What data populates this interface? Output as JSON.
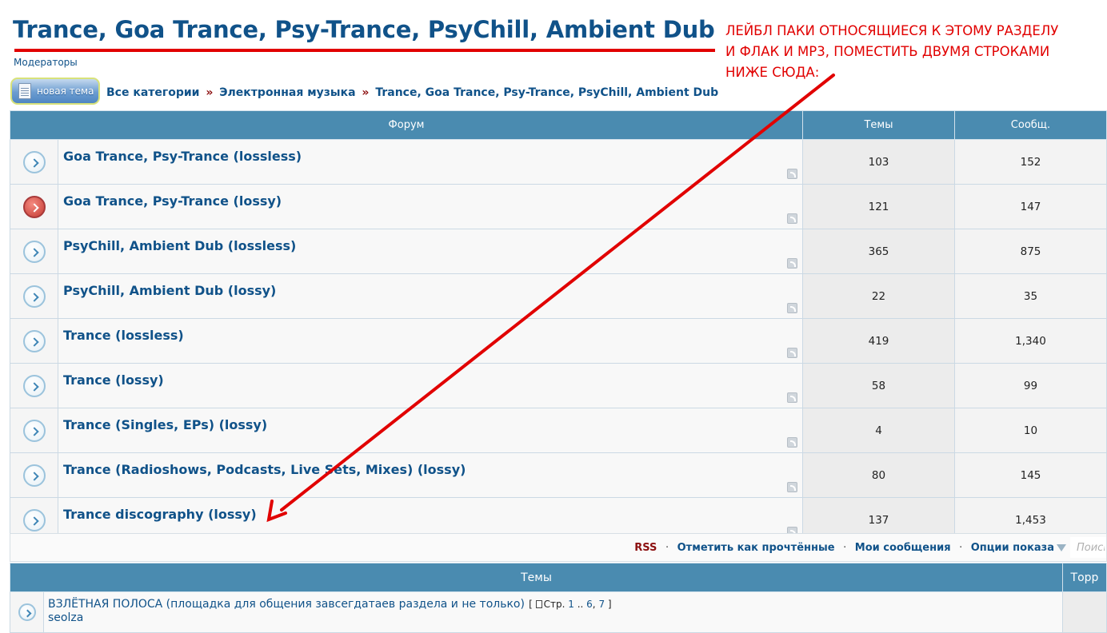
{
  "page": {
    "title": "Trance, Goa Trance, Psy-Trance, PsyChill, Ambient Dub",
    "moderators_label": "Модераторы"
  },
  "toolbar": {
    "new_topic_label": "новая тема"
  },
  "breadcrumbs": {
    "items": [
      "Все категории",
      "Электронная музыка",
      "Trance, Goa Trance, Psy-Trance, PsyChill, Ambient Dub"
    ],
    "separator": "»"
  },
  "annotation": {
    "lines": [
      "ЛЕЙБЛ ПАКИ ОТНОСЯЩИЕСЯ К ЭТОМУ РАЗДЕЛУ",
      "И ФЛАК И MP3, ПОМЕСТИТЬ ДВУМЯ СТРОКАМИ",
      "НИЖЕ СЮДА:"
    ],
    "color": "#e10000"
  },
  "forums_table": {
    "headers": {
      "forum": "Форум",
      "topics": "Темы",
      "posts": "Сообщ."
    },
    "rows": [
      {
        "name": "Goa Trance, Psy-Trance (lossless)",
        "topics": "103",
        "posts": "152",
        "icon": "forum-read-icon"
      },
      {
        "name": "Goa Trance, Psy-Trance (lossy)",
        "topics": "121",
        "posts": "147",
        "icon": "forum-unread-icon"
      },
      {
        "name": "PsyChill, Ambient Dub (lossless)",
        "topics": "365",
        "posts": "875",
        "icon": "forum-read-icon"
      },
      {
        "name": "PsyChill, Ambient Dub (lossy)",
        "topics": "22",
        "posts": "35",
        "icon": "forum-read-icon"
      },
      {
        "name": "Trance (lossless)",
        "topics": "419",
        "posts": "1,340",
        "icon": "forum-read-icon"
      },
      {
        "name": "Trance (lossy)",
        "topics": "58",
        "posts": "99",
        "icon": "forum-read-icon"
      },
      {
        "name": "Trance (Singles, EPs) (lossy)",
        "topics": "4",
        "posts": "10",
        "icon": "forum-read-icon"
      },
      {
        "name": "Trance (Radioshows, Podcasts, Live Sets, Mixes) (lossy)",
        "topics": "80",
        "posts": "145",
        "icon": "forum-read-icon"
      },
      {
        "name": "Trance discography (lossy)",
        "topics": "137",
        "posts": "1,453",
        "icon": "forum-read-icon"
      }
    ]
  },
  "actions": {
    "rss": "RSS",
    "mark_read": "Отметить как прочтённые",
    "my_posts": "Мои сообщения",
    "display_options": "Опции показа",
    "separator": "·",
    "search_placeholder": "Поиск"
  },
  "topics_table": {
    "headers": {
      "topics": "Темы",
      "torrent": "Торр"
    },
    "rows": [
      {
        "title": "ВЗЛЁТНАЯ ПОЛОСА (площадка для общения завсегдатаев раздела и не только)",
        "pages_label": "Стр.",
        "page_first": "1",
        "page_ellipsis": "..",
        "page_a": "6",
        "page_b": "7",
        "open_bracket": "[",
        "close_bracket": "]",
        "comma": ",",
        "author": "seolza"
      }
    ]
  },
  "colors": {
    "header_bg": "#4a8bb0",
    "link": "#105289",
    "annotation_red": "#e10000",
    "rss_red": "#8c1010"
  }
}
